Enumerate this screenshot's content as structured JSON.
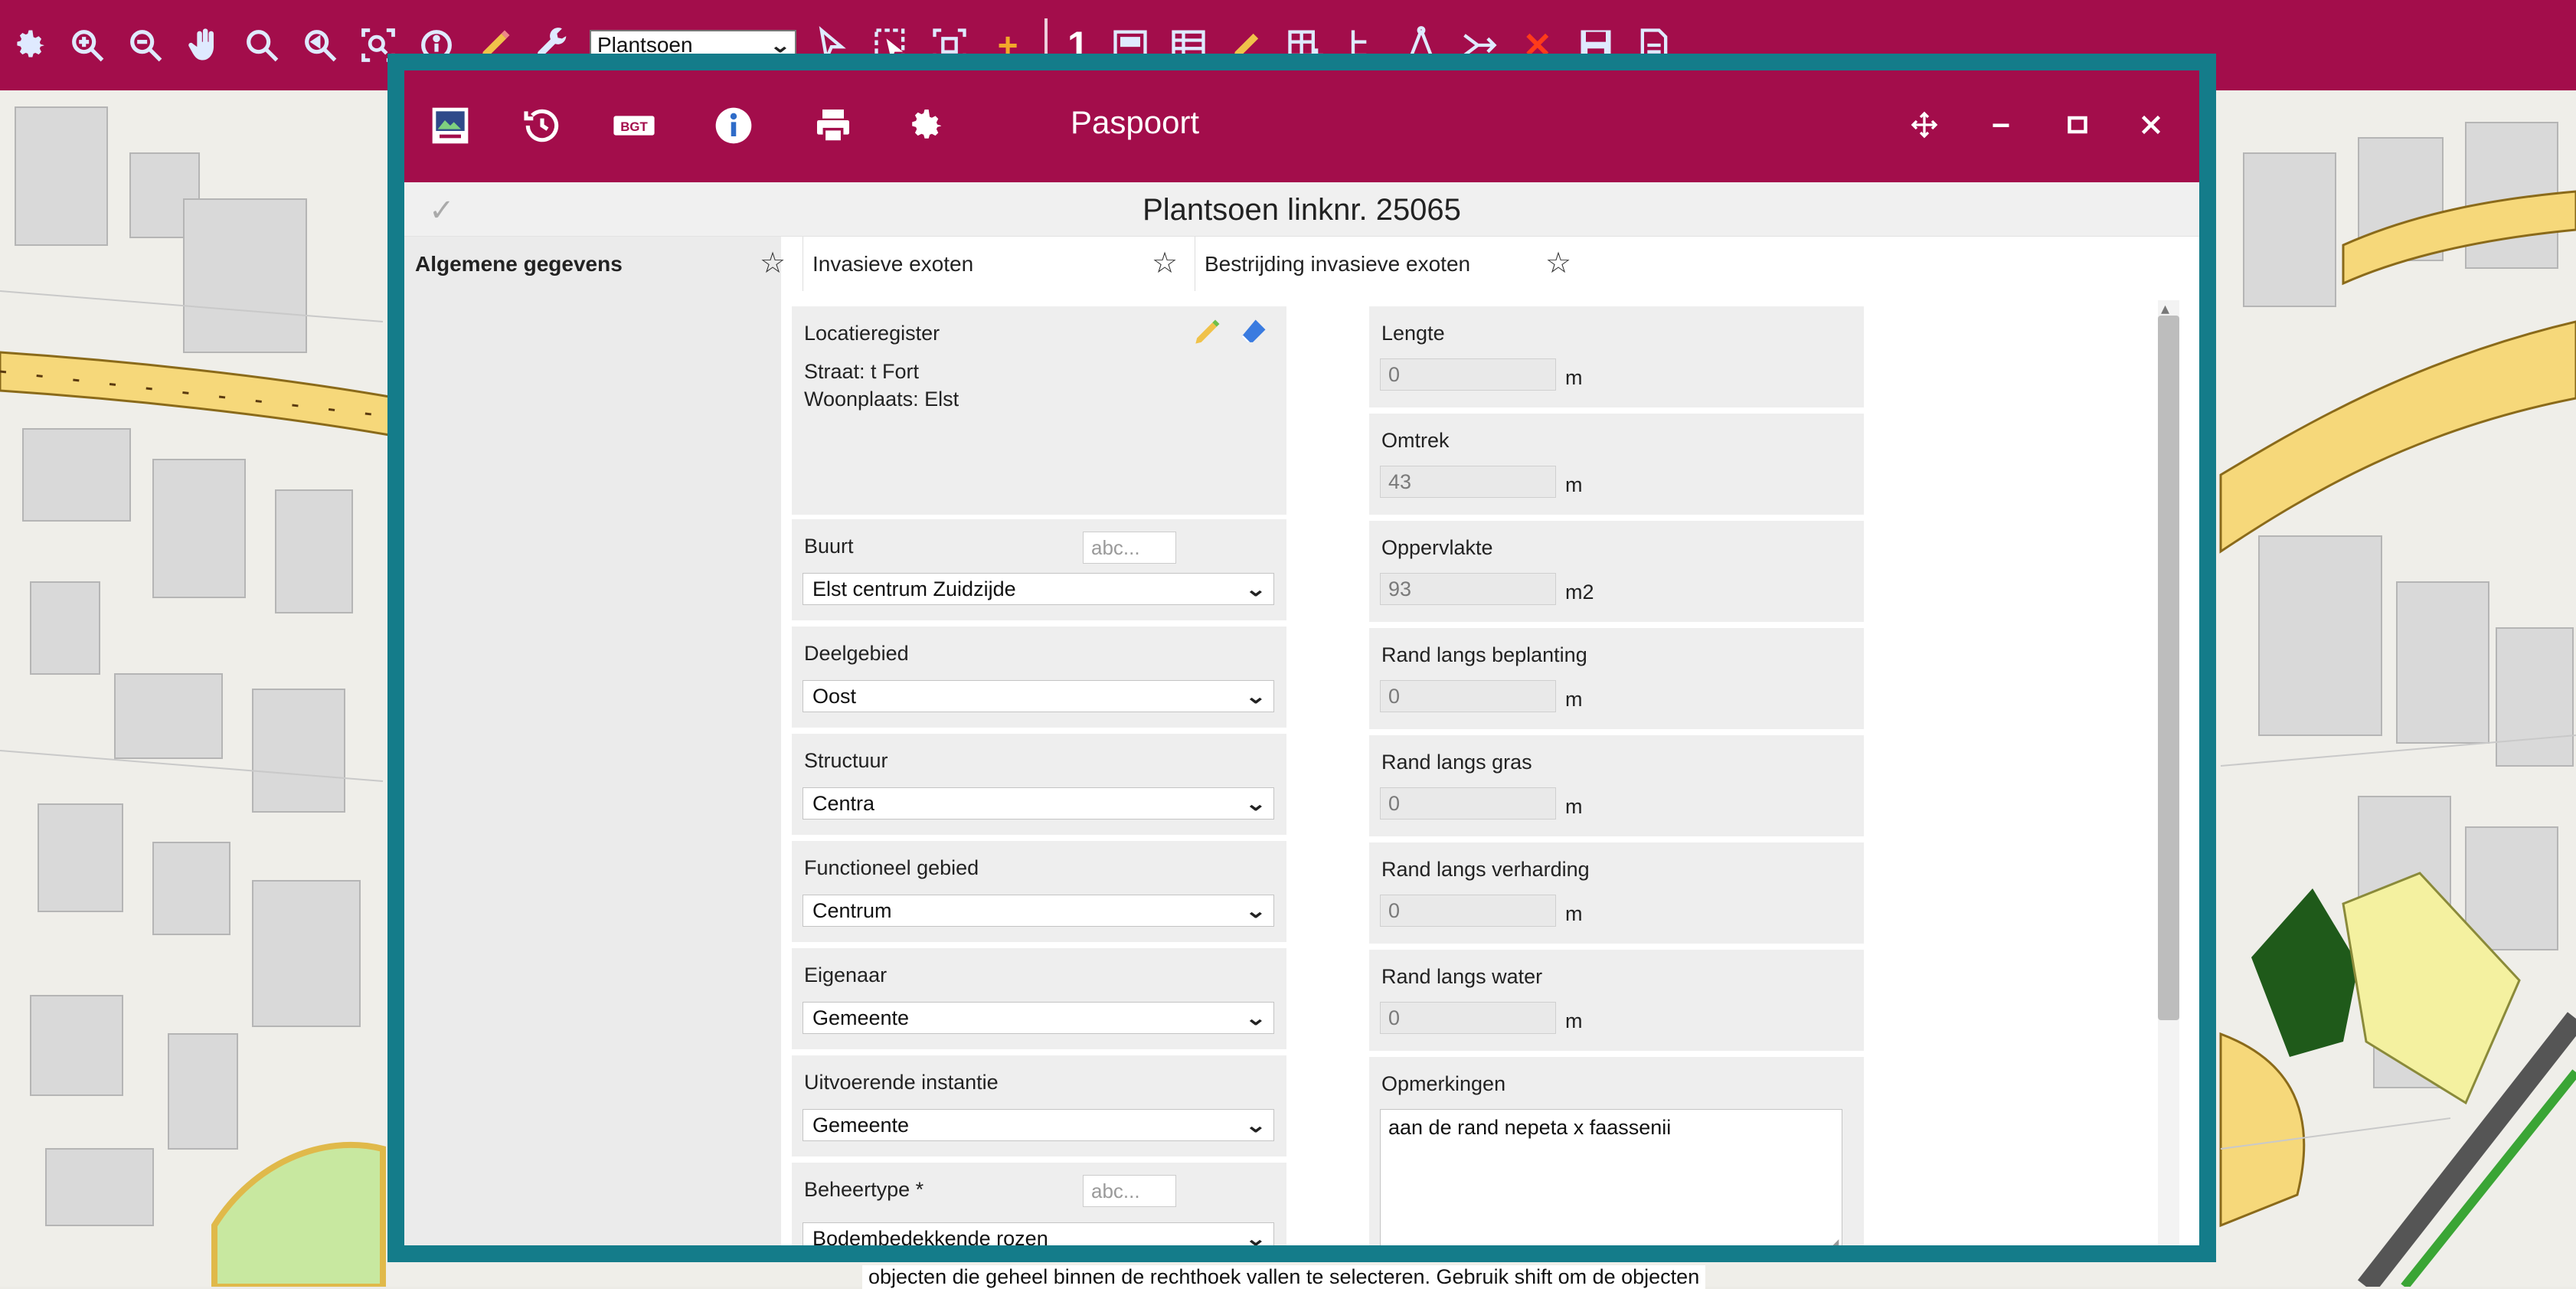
{
  "colors": {
    "toolbar_bg": "#a30d4b",
    "dialog_border": "#147c8a",
    "header_bg": "#a30d4b",
    "map_bg": "#efeee9"
  },
  "toolbar": {
    "layer_select_value": "Plantsoen",
    "counter_value": "1",
    "icons": [
      "gear-icon",
      "zoom-in-icon",
      "zoom-out-icon",
      "pan-hand-icon",
      "zoom-icon",
      "zoom-previous-icon",
      "zoom-extent-icon",
      "info-icon",
      "pencil-icon",
      "wrench-icon",
      "select-arrow-icon",
      "select-area-icon",
      "select-frame-icon",
      "add-icon",
      "list-icon",
      "edit-icon",
      "table-icon",
      "tree-icon",
      "measure-icon",
      "route-icon",
      "delete-icon",
      "save-icon",
      "document-icon"
    ]
  },
  "dialog": {
    "title": "Paspoort",
    "header_icons": [
      "map-passport-icon",
      "history-icon",
      "bgt-icon",
      "info-icon",
      "print-icon",
      "settings-icon"
    ],
    "bgt_label": "BGT",
    "window_buttons": [
      "move-icon",
      "minimize-icon",
      "maximize-icon",
      "close-icon"
    ],
    "record_title": "Plantsoen linknr. 25065"
  },
  "tabs": [
    {
      "label": "Algemene gegevens"
    },
    {
      "label": "Invasieve exoten"
    },
    {
      "label": "Bestrijding invasieve exoten"
    }
  ],
  "left_fields": {
    "locatieregister": {
      "label": "Locatieregister",
      "straat": "Straat: t Fort",
      "woonplaats": "Woonplaats: Elst"
    },
    "buurt": {
      "label": "Buurt",
      "value": "Elst centrum Zuidzijde",
      "abc": "abc..."
    },
    "deelgebied": {
      "label": "Deelgebied",
      "value": "Oost"
    },
    "structuur": {
      "label": "Structuur",
      "value": "Centra"
    },
    "functioneel_gebied": {
      "label": "Functioneel gebied",
      "value": "Centrum"
    },
    "eigenaar": {
      "label": "Eigenaar",
      "value": "Gemeente"
    },
    "uitvoerende_instantie": {
      "label": "Uitvoerende instantie",
      "value": "Gemeente"
    },
    "beheertype": {
      "label": "Beheertype *",
      "value": "Bodembedekkende rozen",
      "abc": "abc..."
    }
  },
  "right_fields": {
    "lengte": {
      "label": "Lengte",
      "value": "0",
      "unit": "m"
    },
    "omtrek": {
      "label": "Omtrek",
      "value": "43",
      "unit": "m"
    },
    "oppervlakte": {
      "label": "Oppervlakte",
      "value": "93",
      "unit": "m2"
    },
    "rand_beplanting": {
      "label": "Rand langs beplanting",
      "value": "0",
      "unit": "m"
    },
    "rand_gras": {
      "label": "Rand langs gras",
      "value": "0",
      "unit": "m"
    },
    "rand_verharding": {
      "label": "Rand langs verharding",
      "value": "0",
      "unit": "m"
    },
    "rand_water": {
      "label": "Rand langs water",
      "value": "0",
      "unit": "m"
    },
    "opmerkingen": {
      "label": "Opmerkingen",
      "value": "aan de rand nepeta x faassenii"
    }
  },
  "status_text": "objecten die geheel binnen de rechthoek vallen te selecteren. Gebruik shift om de objecten"
}
